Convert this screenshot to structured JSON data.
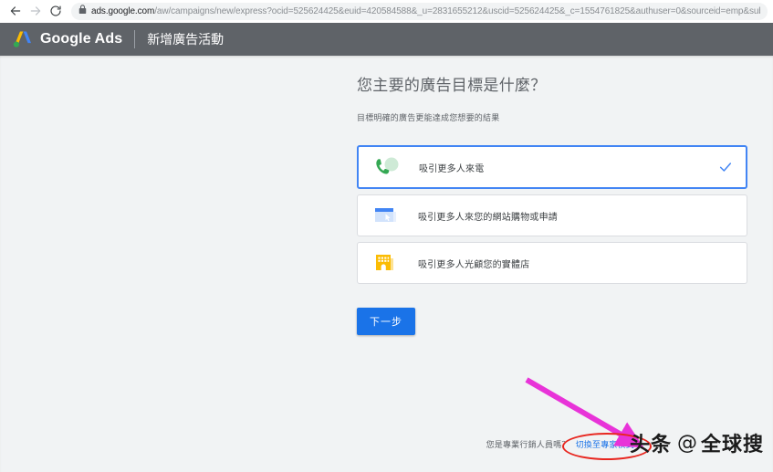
{
  "browser": {
    "back_icon": "arrow-left-icon",
    "forward_icon": "arrow-right-icon",
    "reload_icon": "reload-icon",
    "lock_icon": "lock-icon",
    "url_host": "ads.google.com",
    "url_path": "/aw/campaigns/new/express?ocid=525624425&euid=420584588&_u=2831655212&uscid=525624425&_c=1554761825&authuser=0&sourceid=emp&subid"
  },
  "header": {
    "logo_icon": "google-ads-logo-icon",
    "brand": "Google Ads",
    "page_context": "新增廣告活動"
  },
  "main": {
    "title": "您主要的廣告目標是什麼？",
    "subtitle": "目標明確的廣告更能達成您想要的結果",
    "goals": [
      {
        "label": "吸引更多人來電",
        "icon": "phone-call-icon",
        "selected": true,
        "check_icon": "check-icon"
      },
      {
        "label": "吸引更多人來您的網站購物或申請",
        "icon": "website-window-cursor-icon",
        "selected": false
      },
      {
        "label": "吸引更多人光顧您的實體店",
        "icon": "store-building-icon",
        "selected": false
      }
    ],
    "next_button": "下一步"
  },
  "footer": {
    "question": "您是專業行銷人員嗎？",
    "expert_link": "切換至專家模式"
  },
  "annotations": {
    "arrow_icon": "pink-arrow-annotation",
    "ellipse_icon": "red-ellipse-annotation",
    "arrow_color": "#e833d8",
    "ellipse_color": "#e8261f"
  },
  "watermark": {
    "text": "头条",
    "at": "@",
    "account": "全球搜"
  },
  "colors": {
    "header_bg": "#5f6368",
    "page_bg": "#f1f3f4",
    "accent_blue": "#1a73e8",
    "selected_border": "#4285f4",
    "phone_green": "#34a853",
    "building_yellow": "#fbbc04"
  }
}
